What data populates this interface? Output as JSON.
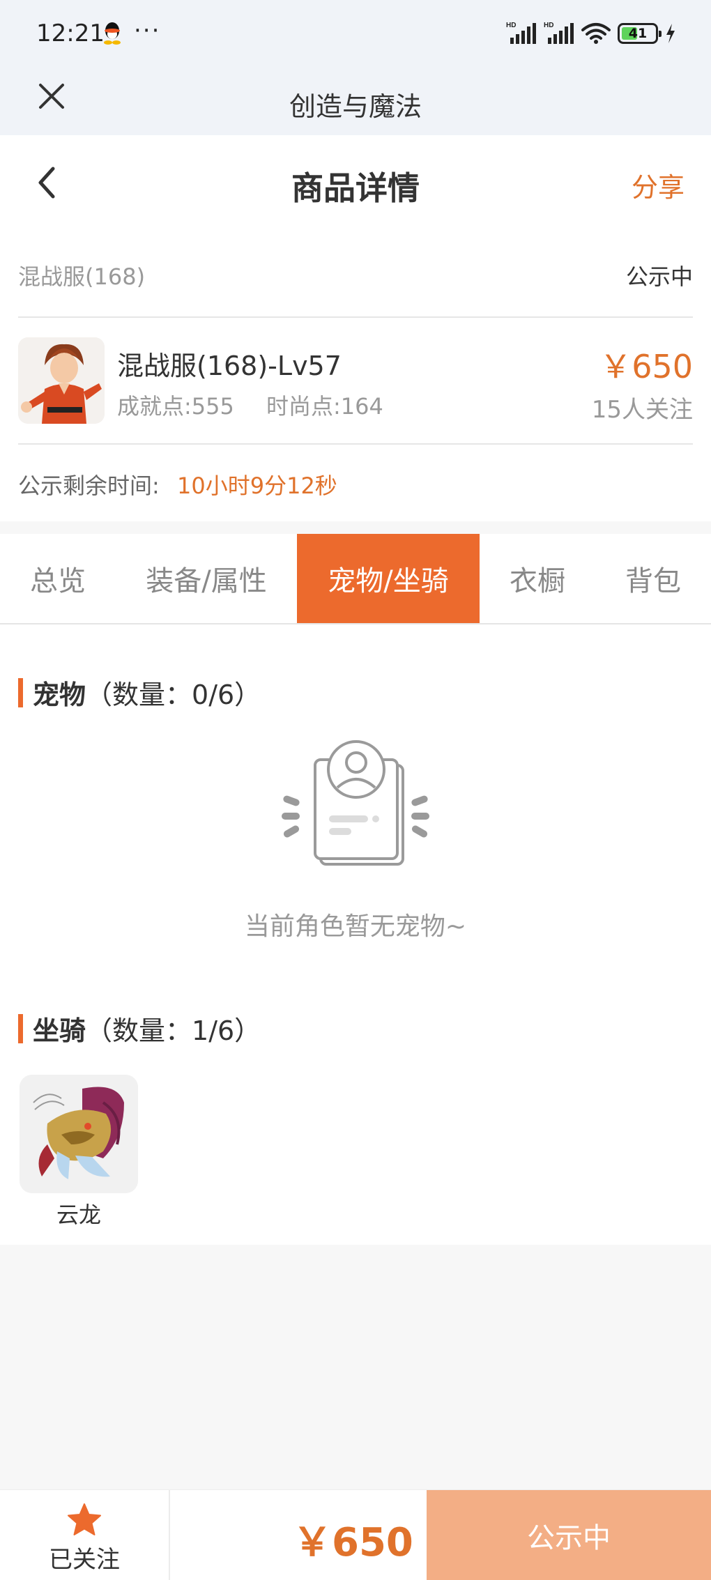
{
  "status_bar": {
    "time": "12:21",
    "dots": "···",
    "battery": "41"
  },
  "app_bar": {
    "title": "创造与魔法"
  },
  "header": {
    "title": "商品详情",
    "share_label": "分享"
  },
  "info": {
    "server": "混战服(168)",
    "status": "公示中",
    "character_name": "混战服(168)-Lv57",
    "achievement_points": "成就点:555",
    "fashion_points": "时尚点:164",
    "price": "￥650",
    "followers": "15人关注",
    "time_left_label": "公示剩余时间:",
    "time_left": "10小时9分12秒"
  },
  "tabs": [
    {
      "label": "总览",
      "active": false
    },
    {
      "label": "装备/属性",
      "active": false
    },
    {
      "label": "宠物/坐骑",
      "active": true
    },
    {
      "label": "衣橱",
      "active": false
    },
    {
      "label": "背包",
      "active": false
    }
  ],
  "pets": {
    "title": "宠物",
    "count": "（数量：0/6）",
    "empty_text": "当前角色暂无宠物~"
  },
  "mounts": {
    "title": "坐骑",
    "count": "（数量：1/6）",
    "items": [
      {
        "name": "云龙"
      }
    ]
  },
  "bottom_bar": {
    "follow_label": "已关注",
    "price": "￥650",
    "action_label": "公示中"
  },
  "colors": {
    "accent": "#ec6a2d",
    "price": "#e0722b",
    "action_button": "#f3ae85"
  }
}
